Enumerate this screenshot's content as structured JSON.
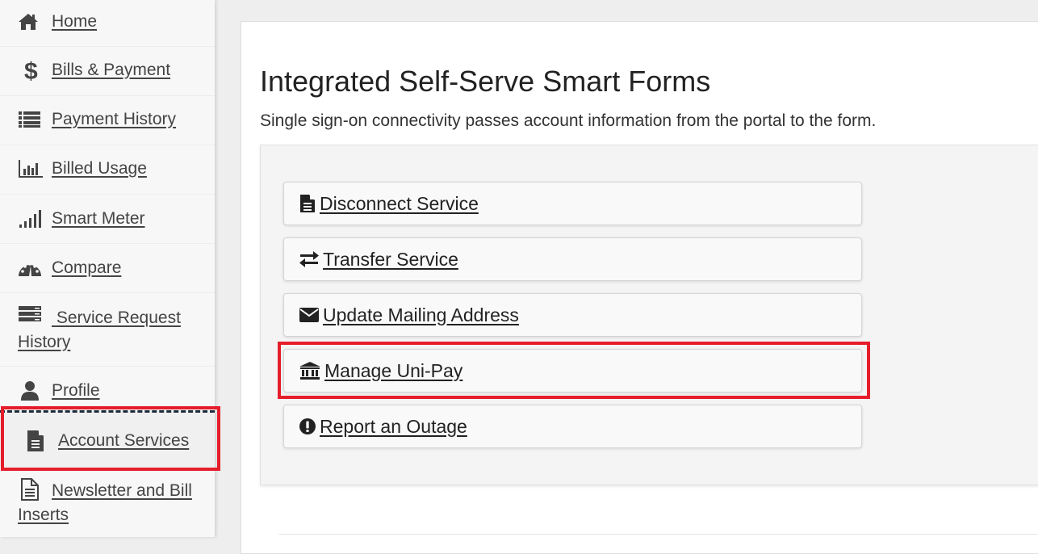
{
  "sidebar": {
    "items": [
      {
        "label": "Home",
        "icon": "home-icon"
      },
      {
        "label": "Bills & Payment",
        "icon": "dollar-icon"
      },
      {
        "label": "Payment History",
        "icon": "list-icon"
      },
      {
        "label": "Billed Usage",
        "icon": "bar-chart-icon"
      },
      {
        "label": "Smart Meter",
        "icon": "signal-icon"
      },
      {
        "label": "Compare",
        "icon": "dashboard-icon"
      },
      {
        "label": " Service Request History",
        "icon": "server-icon"
      },
      {
        "label": "Profile",
        "icon": "user-icon"
      },
      {
        "label": "Account Services",
        "icon": "file-text-icon",
        "active": true
      },
      {
        "label": "Newsletter and Bill Inserts",
        "icon": "file-outline-icon"
      }
    ]
  },
  "main": {
    "title": "Integrated Self-Serve Smart Forms",
    "subtitle": "Single sign-on connectivity passes account information from the portal to the form.",
    "forms": [
      {
        "label": " Disconnect Service",
        "icon": "file-text-icon"
      },
      {
        "label": " Transfer Service",
        "icon": "exchange-icon"
      },
      {
        "label": " Update Mailing Address",
        "icon": "envelope-icon"
      },
      {
        "label": " Manage Uni-Pay",
        "icon": "bank-icon",
        "highlighted": true
      },
      {
        "label": " Report an Outage",
        "icon": "exclamation-circle-icon"
      }
    ]
  },
  "colors": {
    "highlight": "#e51d2a",
    "icon": "#444444"
  }
}
